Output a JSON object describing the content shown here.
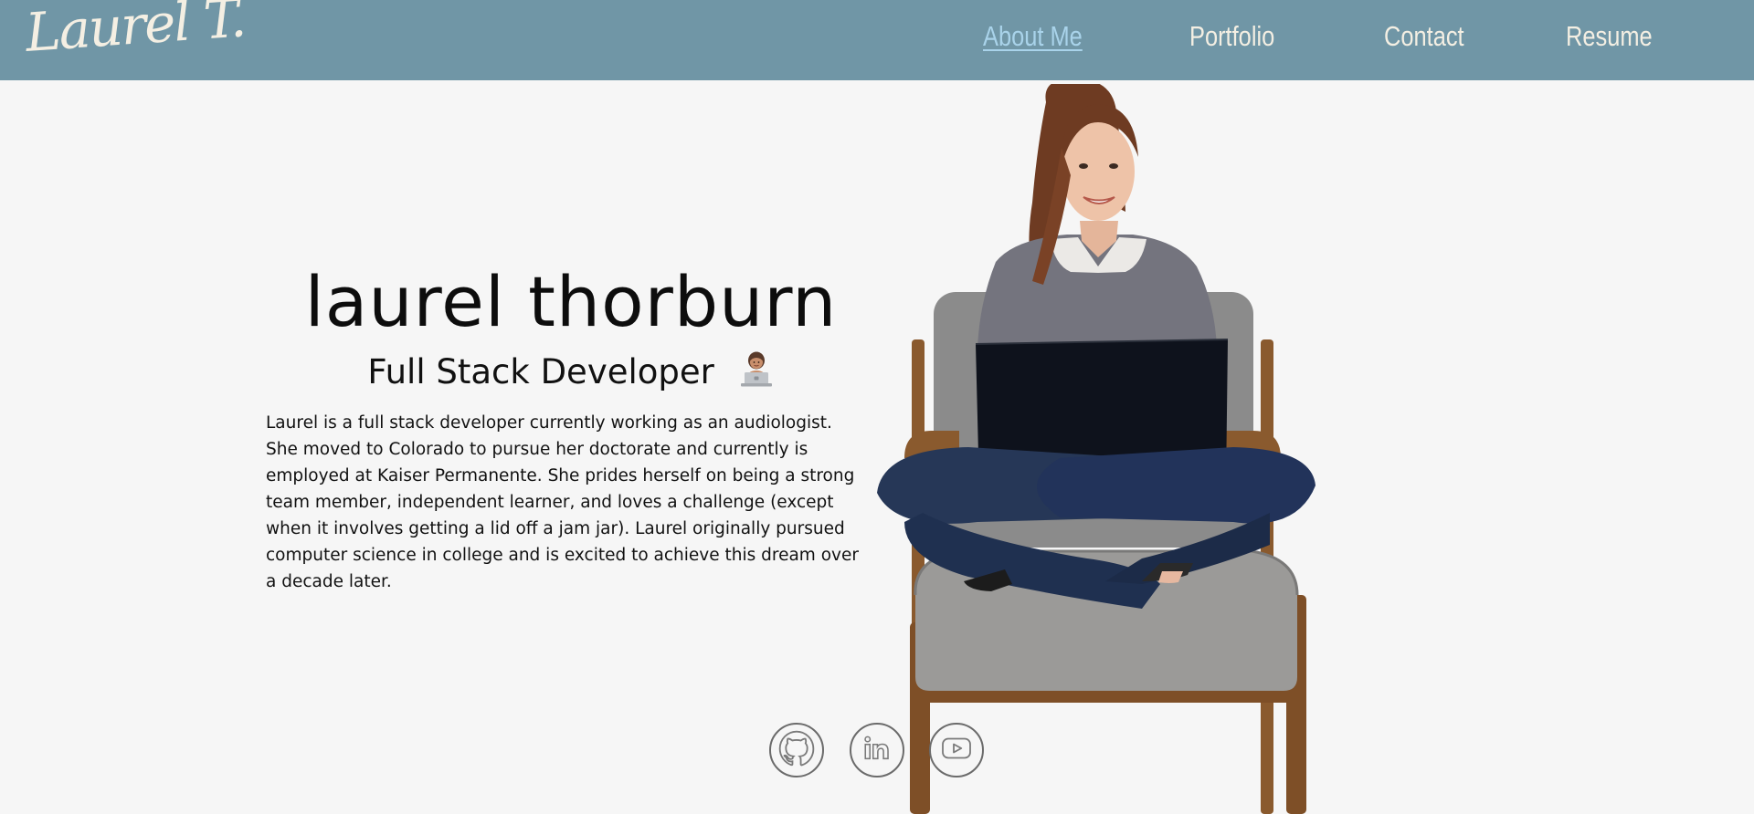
{
  "logo": {
    "text": "Laurel T."
  },
  "nav": {
    "items": [
      {
        "label": "About Me",
        "active": true
      },
      {
        "label": "Portfolio",
        "active": false
      },
      {
        "label": "Contact",
        "active": false
      },
      {
        "label": "Resume",
        "active": false
      }
    ]
  },
  "hero": {
    "name": "laurel thorburn",
    "subtitle": "Full Stack Developer",
    "subtitle_icon": "woman-technologist-icon",
    "bio": "Laurel is a full stack developer currently working as an audiologist. She moved to Colorado to pursue her doctorate and currently is employed at Kaiser Permanente. She prides herself on being a strong team member, independent learner, and loves a challenge (except when it involves getting a lid off a jam jar). Laurel originally pursued computer science in college and is excited to achieve this dream over a decade later."
  },
  "social": [
    {
      "icon": "github-icon"
    },
    {
      "icon": "linkedin-icon"
    },
    {
      "icon": "youtube-icon"
    }
  ],
  "colors": {
    "navbar_bg": "#7096a6",
    "nav_text": "#f4efe3",
    "nav_active": "#a9d3ea",
    "page_bg": "#f6f6f6"
  }
}
